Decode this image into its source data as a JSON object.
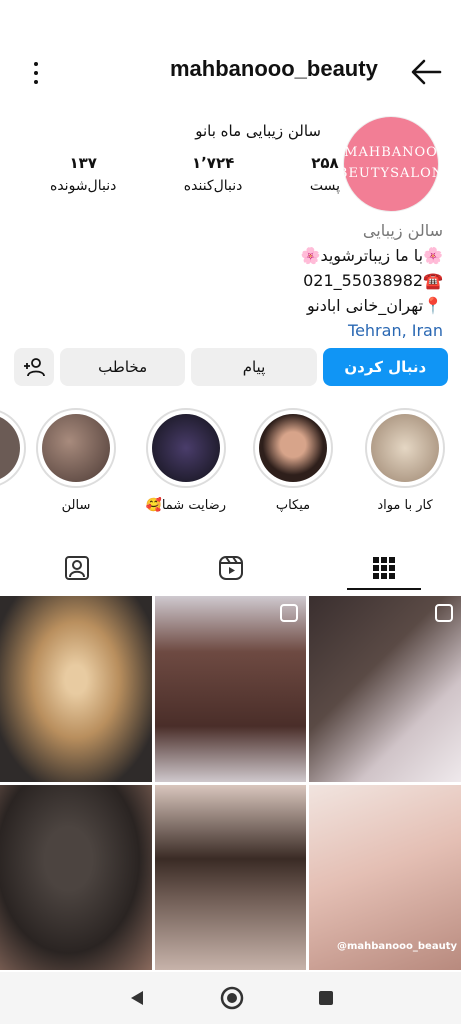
{
  "header": {
    "username": "mahbanooo_beauty"
  },
  "profile": {
    "avatar_line1": "MAHBANOO",
    "avatar_line2": "BEUTYSALON",
    "full_name": "سالن زیبایی ماه بانو",
    "stats": [
      {
        "value": "۲۵۸",
        "label": "پست"
      },
      {
        "value": "۱٬۷۲۴",
        "label": "دنبال‌کننده"
      },
      {
        "value": "۱۳۷",
        "label": "دنبال‌شونده"
      }
    ],
    "category": "سالن زیبایی",
    "bio_line1": "🌸با ما زیباترشوید🌸",
    "bio_line2": "☎️55038982_021",
    "bio_line3": "📍تهران_خانی ابادنو",
    "location": "Tehran, Iran"
  },
  "actions": {
    "follow": "دنبال کردن",
    "message": "پیام",
    "contact": "مخاطب"
  },
  "highlights": [
    {
      "label": "کار با مواد",
      "color": "#c9b59c"
    },
    {
      "label": "میکاپ",
      "color": "#7a5a4c"
    },
    {
      "label": "رضایت شما🥰",
      "color": "#1b1b2b"
    },
    {
      "label": "سالن",
      "color": "#7b5e57"
    }
  ],
  "grid": {
    "watermark": "@mahbanooo_beauty",
    "tile_colors": [
      "#cfa979",
      "#5b3d35",
      "#d7c9cf",
      "#3b3330",
      "#7a6a62",
      "#e2c9c2"
    ]
  },
  "navbar": {
    "icons": [
      "back-triangle-icon",
      "home-circle-icon",
      "recents-square-icon"
    ]
  }
}
